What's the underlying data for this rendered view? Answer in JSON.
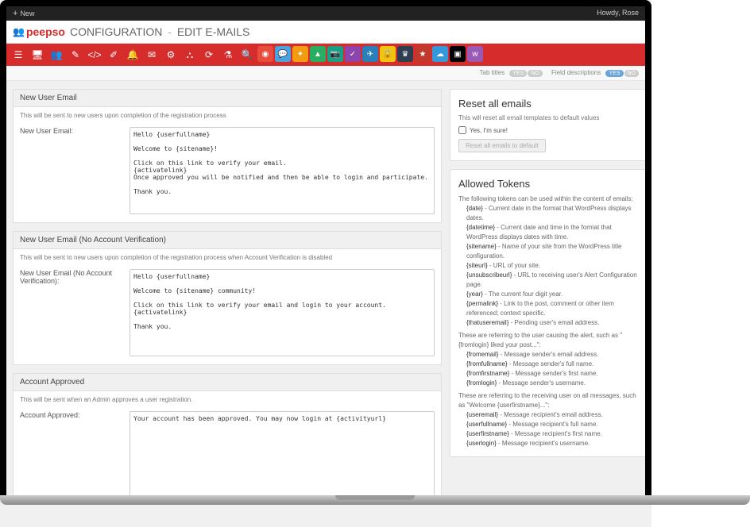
{
  "topbar": {
    "new_label": "New",
    "greeting": "Howdy, Rose"
  },
  "header": {
    "logo": "peepso",
    "crumb1": "CONFIGURATION",
    "crumb2": "EDIT E-MAILS"
  },
  "toolbar_icons": [
    {
      "name": "layers-icon",
      "glyph": "☰",
      "bg": ""
    },
    {
      "name": "monitor-icon",
      "glyph": "🖥",
      "bg": ""
    },
    {
      "name": "user-icon",
      "glyph": "👥",
      "bg": ""
    },
    {
      "name": "edit-icon",
      "glyph": "✎",
      "bg": ""
    },
    {
      "name": "code-icon",
      "glyph": "</>",
      "bg": ""
    },
    {
      "name": "brush-icon",
      "glyph": "✐",
      "bg": ""
    },
    {
      "name": "bell-icon",
      "glyph": "🔔",
      "bg": ""
    },
    {
      "name": "mail-icon",
      "glyph": "✉",
      "bg": ""
    },
    {
      "name": "gear-icon",
      "glyph": "⚙",
      "bg": ""
    },
    {
      "name": "sitemap-icon",
      "glyph": "⛬",
      "bg": ""
    },
    {
      "name": "refresh-icon",
      "glyph": "⟳",
      "bg": ""
    },
    {
      "name": "flask-icon",
      "glyph": "⚗",
      "bg": ""
    },
    {
      "name": "search-icon",
      "glyph": "🔍",
      "bg": ""
    },
    {
      "name": "app1-icon",
      "glyph": "◉",
      "bg": "#e84c3d"
    },
    {
      "name": "app2-icon",
      "glyph": "💬",
      "bg": "#4aa3df"
    },
    {
      "name": "app3-icon",
      "glyph": "✦",
      "bg": "#f39c12"
    },
    {
      "name": "app4-icon",
      "glyph": "▲",
      "bg": "#27ae60"
    },
    {
      "name": "app5-icon",
      "glyph": "📷",
      "bg": "#16a085"
    },
    {
      "name": "app6-icon",
      "glyph": "✓",
      "bg": "#8e44ad"
    },
    {
      "name": "app7-icon",
      "glyph": "✈",
      "bg": "#2980b9"
    },
    {
      "name": "app8-icon",
      "glyph": "🔒",
      "bg": "#f1c40f"
    },
    {
      "name": "app9-icon",
      "glyph": "♛",
      "bg": "#2c3e50"
    },
    {
      "name": "app10-icon",
      "glyph": "★",
      "bg": "#c0392b"
    },
    {
      "name": "app11-icon",
      "glyph": "☁",
      "bg": "#3498db"
    },
    {
      "name": "app12-icon",
      "glyph": "▣",
      "bg": "#000"
    },
    {
      "name": "app13-icon",
      "glyph": "w",
      "bg": "#9b59b6"
    }
  ],
  "subbar": {
    "tab_titles_label": "Tab titles",
    "tab_titles_yes": "YES",
    "tab_titles_no": "NO",
    "field_desc_label": "Field descriptions",
    "field_desc_yes": "YES",
    "field_desc_no": "NO"
  },
  "sections": [
    {
      "title": "New User Email",
      "desc": "This will be sent to new users upon completion of the registration process",
      "label": "New User Email:",
      "value": "Hello {userfullname}\n\nWelcome to {sitename}!\n\nClick on this link to verify your email.\n{activatelink}\nOnce approved you will be notified and then be able to login and participate.\n\nThank you."
    },
    {
      "title": "New User Email (No Account Verification)",
      "desc": "This will be sent to new users upon completion of the registration process when Account Verification is disabled",
      "label": "New User Email (No Account Verification):",
      "value": "Hello {userfullname}\n\nWelcome to {sitename} community!\n\nClick on this link to verify your email and login to your account.\n{activatelink}\n\nThank you."
    },
    {
      "title": "Account Approved",
      "desc": "This will be sent when an Admin approves a user registration.",
      "label": "Account Approved:",
      "value": "Your account has been approved. You may now login at {activityurl}"
    }
  ],
  "reset": {
    "title": "Reset all emails",
    "desc": "This will reset all email templates to default values",
    "checkbox_label": "Yes, I'm sure!",
    "button": "Reset all emails to default"
  },
  "tokens": {
    "title": "Allowed Tokens",
    "intro": "The following tokens can be used within the content of emails:",
    "list1": [
      {
        "k": "{date}",
        "v": "Current date in the format that WordPress displays dates."
      },
      {
        "k": "{datetime}",
        "v": "Current date and time in the format that WordPress displays dates with time."
      },
      {
        "k": "{sitename}",
        "v": "Name of your site from the WordPress title configuration."
      },
      {
        "k": "{siteurl}",
        "v": "URL of your site."
      },
      {
        "k": "{unsubscribeurl}",
        "v": "URL to receiving user's Alert Configuration page."
      },
      {
        "k": "{year}",
        "v": "The current four digit year."
      },
      {
        "k": "{permalink}",
        "v": "Link to the post, comment or other item referenced; context specific."
      },
      {
        "k": "{thatuseremail}",
        "v": "Pending user's email address."
      }
    ],
    "intro2": "These are referring to the user causing the alert, such as \"{fromlogin} liked your post...\":",
    "list2": [
      {
        "k": "{fromemail}",
        "v": "Message sender's email address."
      },
      {
        "k": "{fromfullname}",
        "v": "Message sender's full name."
      },
      {
        "k": "{fromfirstname}",
        "v": "Message sender's first name."
      },
      {
        "k": "{fromlogin}",
        "v": "Message sender's username."
      }
    ],
    "intro3": "These are referring to the receiving user on all messages, such as \"Welcome {userfirstname}...\":",
    "list3": [
      {
        "k": "{useremail}",
        "v": "Message recipient's email address."
      },
      {
        "k": "{userfullname}",
        "v": "Message recipient's full name."
      },
      {
        "k": "{userfirstname}",
        "v": "Message recipient's first name."
      },
      {
        "k": "{userlogin}",
        "v": "Message recipient's username."
      }
    ]
  }
}
